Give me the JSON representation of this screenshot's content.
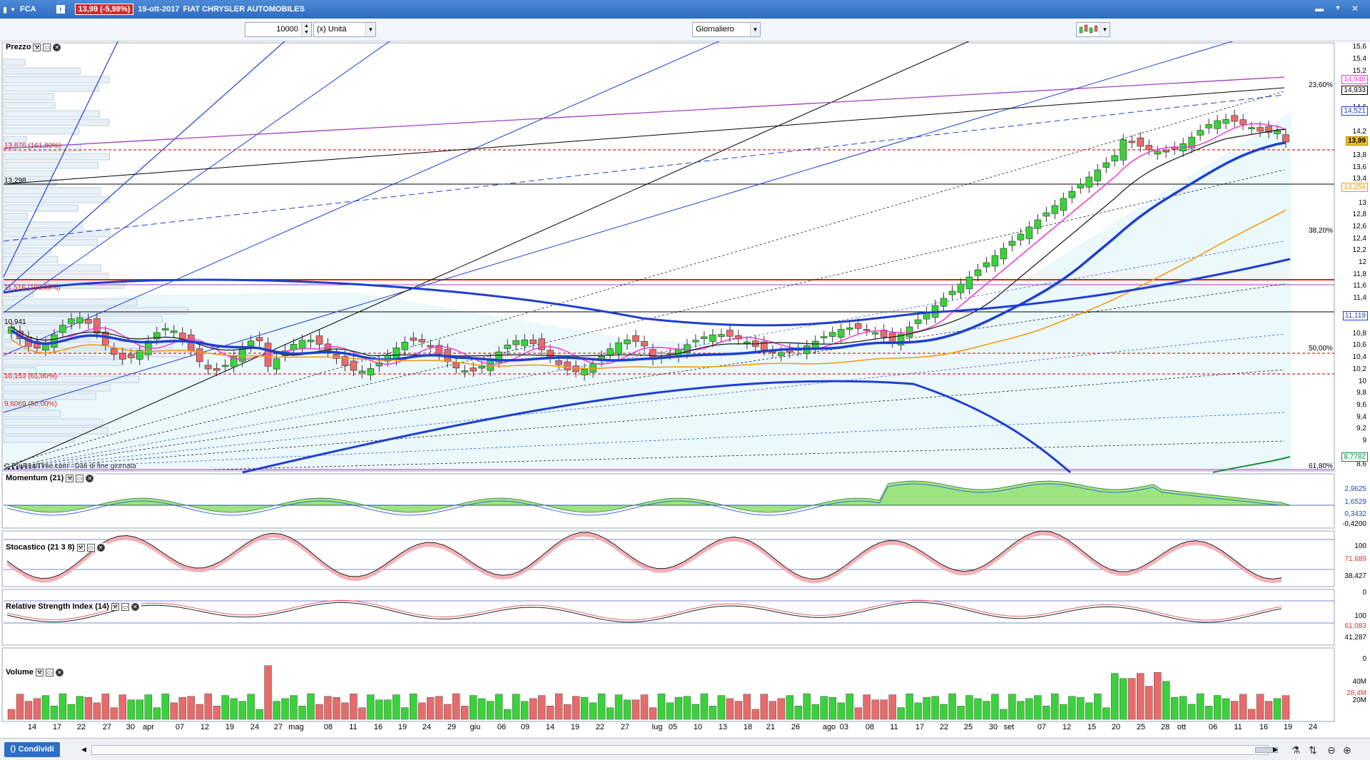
{
  "window": {
    "symbol": "FCA",
    "price_change": "13,99 (-5,98%)",
    "date": "19-ott-2017",
    "instrument_name": "FIAT CHRYSLER AUTOMOBILES"
  },
  "toolbar": {
    "quantity": "10000",
    "unit": "(x) Unità",
    "period": "Giornaliero"
  },
  "panels": {
    "price_label": "Prezzo",
    "momentum_label": "Momentum (21)",
    "stochastic_label": "Stocastico (21 3 8)",
    "rsi_label": "Relative Strength Index (14)",
    "volume_label": "Volume"
  },
  "price_axis": [
    "15,6",
    "15,4",
    "15,2",
    "14,933",
    "14,6",
    "14,2",
    "14",
    "13,8",
    "13,6",
    "13,4",
    "13",
    "12,8",
    "12,6",
    "12,4",
    "12,2",
    "12",
    "11,8",
    "11,6",
    "11,4",
    "10,8",
    "10,6",
    "10,4",
    "10,2",
    "10",
    "9,8",
    "9,6",
    "9,4",
    "9,2",
    "9",
    "8,6"
  ],
  "price_badges": {
    "last": "13,99",
    "ma_pink": "14,948",
    "ma_blue": "14,521",
    "ma_orange": "13,254",
    "ma_blue_long": "11,119",
    "ma_green": "8,7782",
    "current": "14,933"
  },
  "fib_labels": {
    "f236": "23,60%",
    "f382": "38,20%",
    "f500": "50,00%",
    "f618": "61,80%"
  },
  "left_levels": {
    "l1": "13,876 (161,80%)",
    "l2": "13,298",
    "l3": "11,516 (100,00%)",
    "l4": "10,941",
    "l5": "10,151 (61,80%)",
    "l6": "9,6069 (50,00%)"
  },
  "watermark": "© ProRealTime.com - Dati di fine giornata",
  "momentum_axis": [
    "2,9625",
    "1,6529",
    "0,3432",
    "-0,4200"
  ],
  "stochastic_axis": [
    "100",
    "71,689",
    "38,427",
    "0"
  ],
  "rsi_axis": [
    "100",
    "61,083",
    "41,287",
    "0"
  ],
  "volume_axis": [
    "40M",
    "28,4M",
    "20M"
  ],
  "x_labels": [
    "14",
    "17",
    "22",
    "27",
    "30",
    "apr",
    "07",
    "12",
    "19",
    "24",
    "27",
    "mag",
    "08",
    "11",
    "16",
    "19",
    "24",
    "29",
    "giu",
    "06",
    "09",
    "14",
    "19",
    "22",
    "27",
    "lug",
    "05",
    "10",
    "13",
    "18",
    "21",
    "26",
    "ago",
    "03",
    "08",
    "11",
    "17",
    "22",
    "25",
    "30",
    "set",
    "07",
    "12",
    "15",
    "20",
    "25",
    "28",
    "ott",
    "06",
    "11",
    "16",
    "19",
    "24"
  ],
  "bottom": {
    "share": "Condividi"
  },
  "colors": {
    "up": "#3ad23a",
    "down": "#e86b6b",
    "title_bar": "#2f6bbf",
    "ma_pink": "#ee3ccf",
    "ma_blue": "#1f3fd0",
    "ma_orange": "#f29b16",
    "level_red": "#e02020"
  }
}
